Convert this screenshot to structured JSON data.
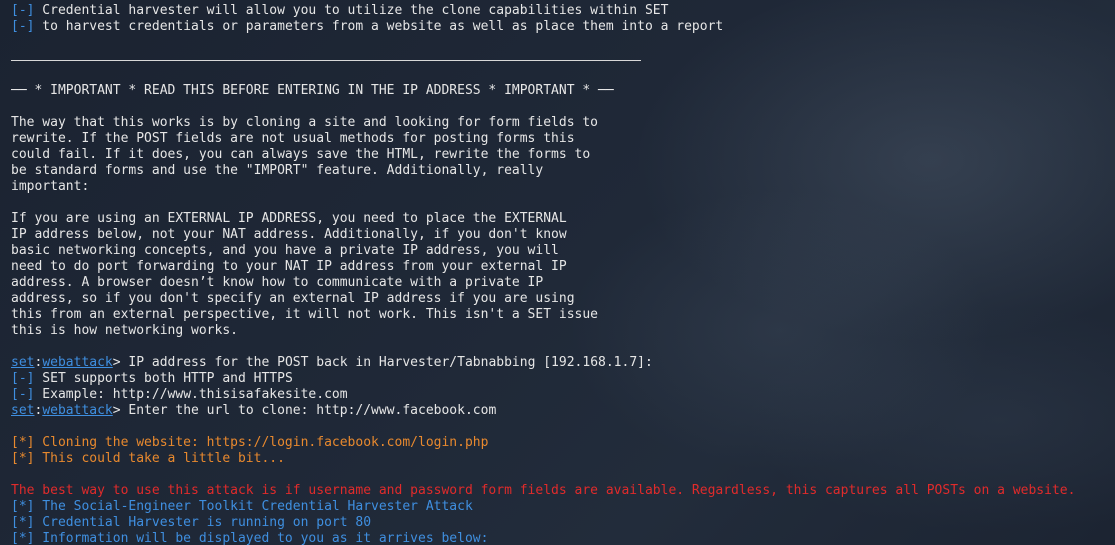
{
  "intro": {
    "line1_marker": "[-]",
    "line1_text": " Credential harvester will allow you to utilize the clone capabilities within SET",
    "line2_marker": "[-]",
    "line2_text": " to harvest credentials or parameters from a website as well as place them into a report"
  },
  "important_banner": "── * IMPORTANT * READ THIS BEFORE ENTERING IN THE IP ADDRESS * IMPORTANT * ──",
  "para1": [
    "The way that this works is by cloning a site and looking for form fields to",
    "rewrite. If the POST fields are not usual methods for posting forms this",
    "could fail. If it does, you can always save the HTML, rewrite the forms to",
    "be standard forms and use the \"IMPORT\" feature. Additionally, really",
    "important:"
  ],
  "para2": [
    "If you are using an EXTERNAL IP ADDRESS, you need to place the EXTERNAL",
    "IP address below, not your NAT address. Additionally, if you don't know",
    "basic networking concepts, and you have a private IP address, you will",
    "need to do port forwarding to your NAT IP address from your external IP",
    "address. A browser doesn’t know how to communicate with a private IP",
    "address, so if you don't specify an external IP address if you are using",
    "this from an external perspective, it will not work. This isn't a SET issue",
    "this is how networking works."
  ],
  "prompt1": {
    "set": "set",
    "colon": ":",
    "module": "webattack",
    "text": "> IP address for the POST back in Harvester/Tabnabbing [192.168.1.7]:"
  },
  "info_lines": [
    {
      "marker": "[-]",
      "text": " SET supports both HTTP and HTTPS"
    },
    {
      "marker": "[-]",
      "text": " Example: http://www.thisisafakesite.com"
    }
  ],
  "prompt2": {
    "set": "set",
    "colon": ":",
    "module": "webattack",
    "text": "> Enter the url to clone: http://www.facebook.com"
  },
  "orange_lines": [
    "[*] Cloning the website: https://login.facebook.com/login.php",
    "[*] This could take a little bit..."
  ],
  "warning": "The best way to use this attack is if username and password form fields are available. Regardless, this captures all POSTs on a website.",
  "status_lines": [
    "[*] The Social-Engineer Toolkit Credential Harvester Attack",
    "[*] Credential Harvester is running on port 80",
    "[*] Information will be displayed to you as it arrives below:"
  ],
  "colors": {
    "background": "#1a2230",
    "text": "#e6e6e6",
    "blue": "#3f8fe0",
    "orange": "#e8892e",
    "red": "#e02b2b"
  }
}
